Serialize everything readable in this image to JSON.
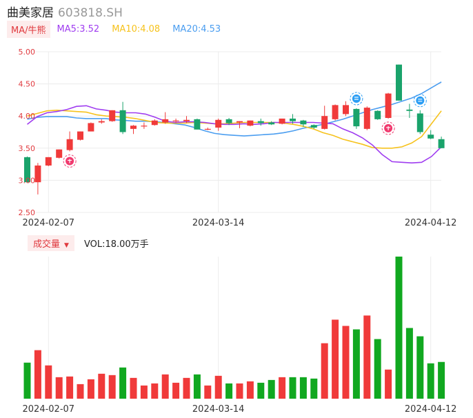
{
  "header": {
    "name": "曲美家居",
    "code": "603818.SH"
  },
  "ma_legend": {
    "tag": "MA/牛熊",
    "ma5": "MA5:3.52",
    "ma10": "MA10:4.08",
    "ma20": "MA20:4.53"
  },
  "volume_legend": {
    "tag": "成交量",
    "text": "VOL:18.00万手"
  },
  "colors": {
    "up": "#f03a3a",
    "down": "#1aa36b",
    "vol_down": "#11a820",
    "ma5": "#9f3cf0",
    "ma10": "#f6c21c",
    "ma20": "#4a9df0",
    "label": "#e0393e"
  },
  "icons": {
    "bull": "bull-badge-icon",
    "bear": "bear-badge-icon"
  },
  "chart_data": {
    "type": "candlestick",
    "y_ticks": [
      "5.00",
      "4.50",
      "4.00",
      "3.50",
      "3.00",
      "2.50"
    ],
    "ylim": [
      2.5,
      5.0
    ],
    "x_tick_labels": [
      "2024-02-07",
      "2024-03-14",
      "2024-04-12"
    ],
    "x_tick_index": [
      2,
      18,
      38
    ],
    "candles": [
      {
        "o": 3.36,
        "h": 3.37,
        "l": 2.97,
        "c": 2.97
      },
      {
        "o": 2.97,
        "h": 3.27,
        "l": 2.78,
        "c": 3.23
      },
      {
        "o": 3.23,
        "h": 3.36,
        "l": 3.22,
        "c": 3.36
      },
      {
        "o": 3.35,
        "h": 3.48,
        "l": 3.34,
        "c": 3.48
      },
      {
        "o": 3.47,
        "h": 3.76,
        "l": 3.45,
        "c": 3.64
      },
      {
        "o": 3.63,
        "h": 3.76,
        "l": 3.62,
        "c": 3.76
      },
      {
        "o": 3.76,
        "h": 3.9,
        "l": 3.76,
        "c": 3.89
      },
      {
        "o": 3.9,
        "h": 3.95,
        "l": 3.88,
        "c": 3.92
      },
      {
        "o": 3.92,
        "h": 4.09,
        "l": 3.91,
        "c": 4.09
      },
      {
        "o": 4.09,
        "h": 4.22,
        "l": 3.72,
        "c": 3.75
      },
      {
        "o": 3.8,
        "h": 3.86,
        "l": 3.72,
        "c": 3.85
      },
      {
        "o": 3.85,
        "h": 3.9,
        "l": 3.8,
        "c": 3.85
      },
      {
        "o": 3.86,
        "h": 3.95,
        "l": 3.85,
        "c": 3.93
      },
      {
        "o": 3.9,
        "h": 4.06,
        "l": 3.88,
        "c": 3.95
      },
      {
        "o": 3.92,
        "h": 3.96,
        "l": 3.89,
        "c": 3.93
      },
      {
        "o": 3.92,
        "h": 4.0,
        "l": 3.89,
        "c": 3.94
      },
      {
        "o": 3.95,
        "h": 3.96,
        "l": 3.79,
        "c": 3.79
      },
      {
        "o": 3.8,
        "h": 3.82,
        "l": 3.78,
        "c": 3.8
      },
      {
        "o": 3.82,
        "h": 3.96,
        "l": 3.77,
        "c": 3.94
      },
      {
        "o": 3.95,
        "h": 3.97,
        "l": 3.86,
        "c": 3.89
      },
      {
        "o": 3.9,
        "h": 3.92,
        "l": 3.81,
        "c": 3.92
      },
      {
        "o": 3.85,
        "h": 3.93,
        "l": 3.84,
        "c": 3.93
      },
      {
        "o": 3.92,
        "h": 3.96,
        "l": 3.85,
        "c": 3.89
      },
      {
        "o": 3.9,
        "h": 3.92,
        "l": 3.86,
        "c": 3.87
      },
      {
        "o": 3.88,
        "h": 3.96,
        "l": 3.87,
        "c": 3.96
      },
      {
        "o": 3.96,
        "h": 4.03,
        "l": 3.88,
        "c": 3.92
      },
      {
        "o": 3.93,
        "h": 3.94,
        "l": 3.83,
        "c": 3.87
      },
      {
        "o": 3.86,
        "h": 3.87,
        "l": 3.8,
        "c": 3.82
      },
      {
        "o": 3.8,
        "h": 4.16,
        "l": 3.79,
        "c": 4.0
      },
      {
        "o": 3.95,
        "h": 4.18,
        "l": 3.93,
        "c": 4.17
      },
      {
        "o": 4.03,
        "h": 4.23,
        "l": 4.0,
        "c": 4.17
      },
      {
        "o": 4.11,
        "h": 4.12,
        "l": 3.8,
        "c": 3.84
      },
      {
        "o": 3.8,
        "h": 4.15,
        "l": 3.78,
        "c": 4.13
      },
      {
        "o": 4.08,
        "h": 4.09,
        "l": 3.94,
        "c": 3.95
      },
      {
        "o": 3.97,
        "h": 4.36,
        "l": 3.96,
        "c": 4.35
      },
      {
        "o": 4.8,
        "h": 4.8,
        "l": 4.24,
        "c": 4.24
      },
      {
        "o": 4.1,
        "h": 4.19,
        "l": 3.97,
        "c": 4.08
      },
      {
        "o": 4.04,
        "h": 4.09,
        "l": 3.72,
        "c": 3.75
      },
      {
        "o": 3.71,
        "h": 3.78,
        "l": 3.64,
        "c": 3.65
      },
      {
        "o": 3.64,
        "h": 3.68,
        "l": 3.5,
        "c": 3.5
      }
    ],
    "ma5": [
      3.87,
      3.99,
      4.05,
      4.07,
      4.1,
      4.15,
      4.16,
      4.11,
      4.09,
      4.06,
      4.05,
      4.05,
      4.03,
      3.98,
      3.92,
      3.9,
      3.91,
      3.91,
      3.9,
      3.88,
      3.87,
      3.87,
      3.88,
      3.87,
      3.88,
      3.9,
      3.9,
      3.9,
      3.9,
      3.9,
      3.89,
      3.88,
      3.8,
      3.74,
      3.66,
      3.55,
      3.4,
      3.29,
      3.28,
      3.27,
      3.28,
      3.37,
      3.52
    ],
    "ma10": [
      4.0,
      4.04,
      4.08,
      4.09,
      4.08,
      4.07,
      4.06,
      4.02,
      4.0,
      3.99,
      3.98,
      3.96,
      3.93,
      3.9,
      3.89,
      3.89,
      3.89,
      3.9,
      3.89,
      3.88,
      3.88,
      3.89,
      3.9,
      3.9,
      3.9,
      3.9,
      3.89,
      3.87,
      3.84,
      3.8,
      3.74,
      3.7,
      3.64,
      3.6,
      3.56,
      3.51,
      3.5,
      3.5,
      3.52,
      3.58,
      3.68,
      3.88,
      4.08
    ],
    "ma20": [
      3.95,
      3.98,
      3.99,
      3.99,
      3.99,
      3.97,
      3.96,
      3.96,
      3.96,
      3.94,
      3.93,
      3.92,
      3.92,
      3.91,
      3.9,
      3.88,
      3.86,
      3.82,
      3.77,
      3.73,
      3.71,
      3.7,
      3.69,
      3.7,
      3.71,
      3.72,
      3.74,
      3.77,
      3.81,
      3.84,
      3.87,
      3.91,
      3.95,
      4.0,
      4.05,
      4.1,
      4.14,
      4.18,
      4.23,
      4.28,
      4.35,
      4.44,
      4.53
    ],
    "ma_x_start": -1,
    "volume": [
      52,
      70,
      48,
      31,
      32,
      21,
      28,
      36,
      34,
      45,
      30,
      19,
      22,
      35,
      23,
      30,
      35,
      19,
      33,
      22,
      22,
      25,
      23,
      27,
      31,
      31,
      31,
      29,
      80,
      114,
      105,
      100,
      120,
      86,
      42,
      205,
      102,
      90,
      51,
      53
    ],
    "volume_ylim": [
      0,
      205
    ],
    "markers": [
      {
        "type": "bull",
        "index": 4
      },
      {
        "type": "bear",
        "index": 31
      },
      {
        "type": "bull",
        "index": 34
      },
      {
        "type": "bear",
        "index": 37
      }
    ]
  }
}
